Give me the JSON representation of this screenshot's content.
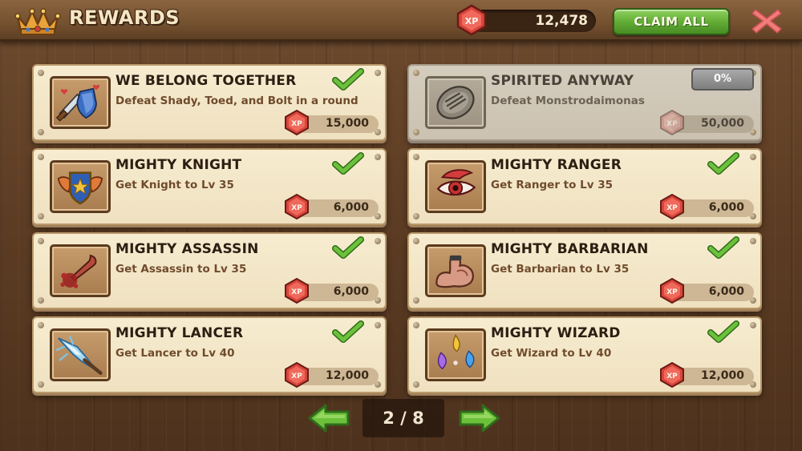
{
  "header": {
    "title": "REWARDS",
    "xp_total": "12,478",
    "xp_gem_label": "XP",
    "claim_all": "CLAIM ALL"
  },
  "rewards": [
    {
      "title": "WE BELONG TOGETHER",
      "desc": "Defeat Shady, Toed, and Bolt in a round",
      "xp_label": "XP",
      "amount": "15,000",
      "completed": true,
      "icon": "sword-shield-hearts-icon"
    },
    {
      "title": "SPIRITED ANYWAY",
      "desc": "Defeat Monstrodaimonas",
      "xp_label": "XP",
      "amount": "50,000",
      "completed": false,
      "progress": "0%",
      "icon": "spirit-shell-icon"
    },
    {
      "title": "MIGHTY KNIGHT",
      "desc": "Get Knight to Lv 35",
      "xp_label": "XP",
      "amount": "6,000",
      "completed": true,
      "icon": "winged-shield-icon"
    },
    {
      "title": "MIGHTY RANGER",
      "desc": "Get Ranger to Lv 35",
      "xp_label": "XP",
      "amount": "6,000",
      "completed": true,
      "icon": "eagle-eye-icon"
    },
    {
      "title": "MIGHTY ASSASSIN",
      "desc": "Get Assassin to Lv 35",
      "xp_label": "XP",
      "amount": "6,000",
      "completed": true,
      "icon": "bloody-dagger-icon"
    },
    {
      "title": "MIGHTY BARBARIAN",
      "desc": "Get Barbarian to Lv 35",
      "xp_label": "XP",
      "amount": "6,000",
      "completed": true,
      "icon": "flexed-arm-icon"
    },
    {
      "title": "MIGHTY LANCER",
      "desc": "Get Lancer to Lv 40",
      "xp_label": "XP",
      "amount": "12,000",
      "completed": true,
      "icon": "lance-tip-icon"
    },
    {
      "title": "MIGHTY WIZARD",
      "desc": "Get Wizard to Lv 40",
      "xp_label": "XP",
      "amount": "12,000",
      "completed": true,
      "icon": "magic-flames-icon"
    }
  ],
  "pagination": {
    "label": "2 / 8"
  },
  "colors": {
    "accent_green": "#5faa33",
    "close_red": "#e86a6a",
    "xp_gem": "#d8453a"
  }
}
